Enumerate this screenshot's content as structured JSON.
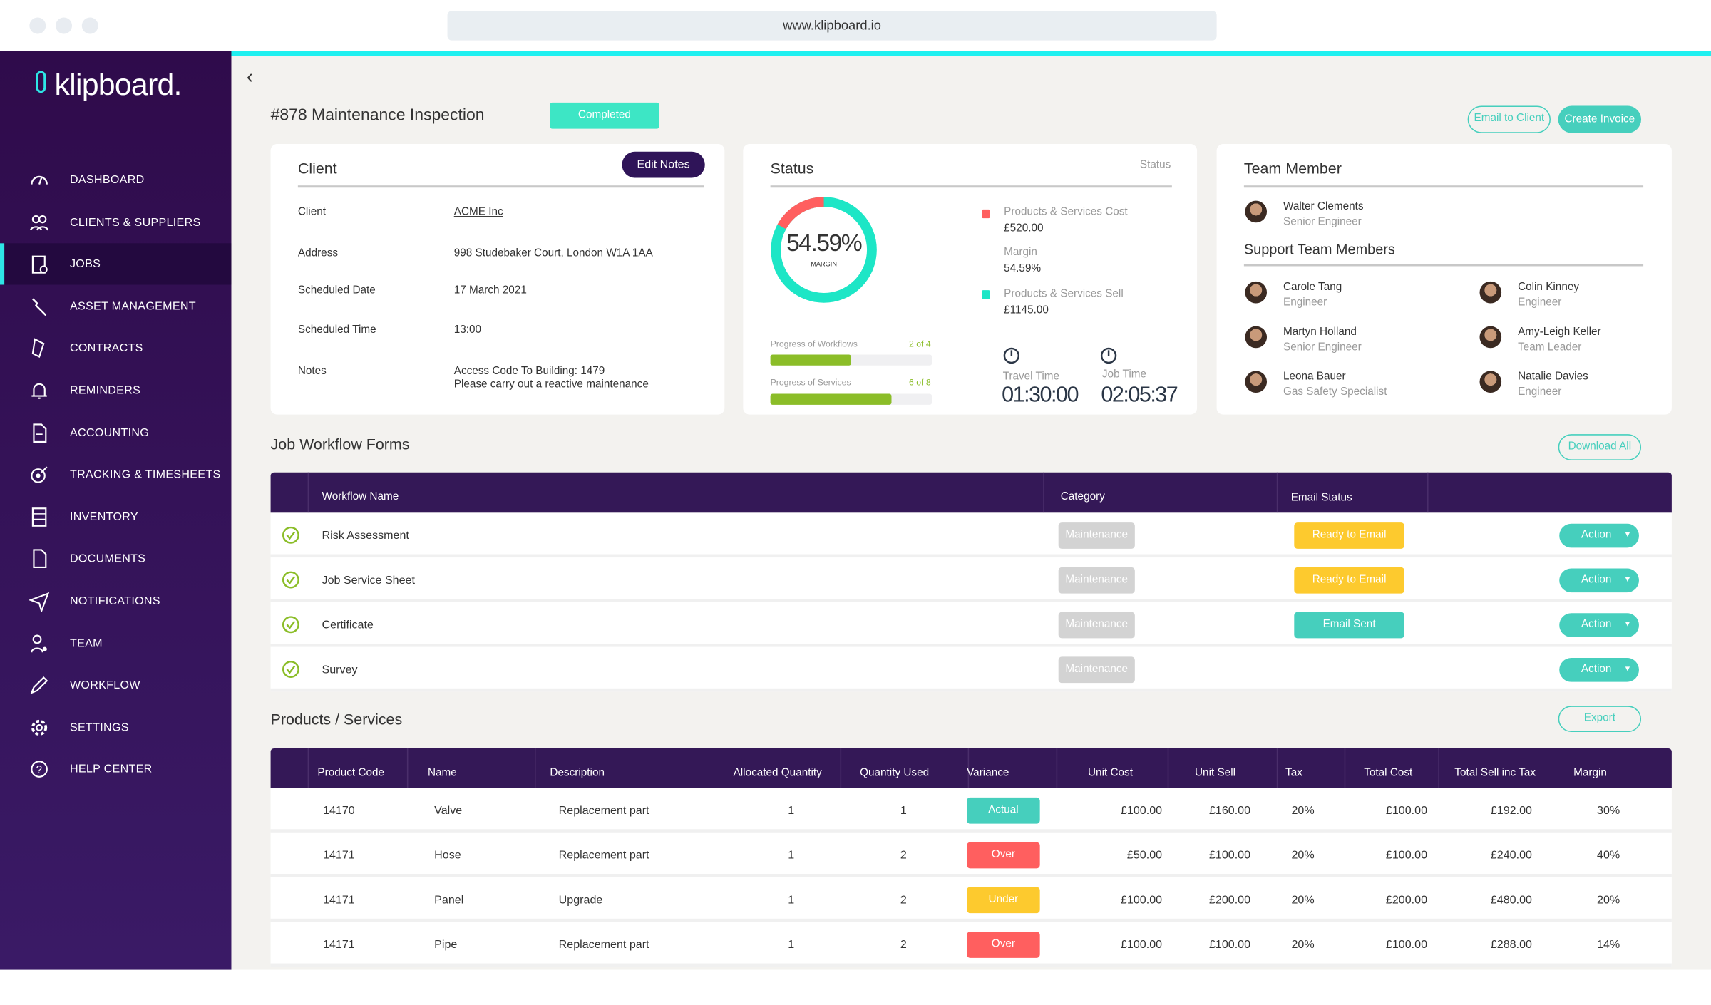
{
  "browser": {
    "url": "www.klipboard.io"
  },
  "brand": {
    "name": "klipboard."
  },
  "colors": {
    "sidebar": "#2f0b4b",
    "accent": "#46cfbd",
    "cyan": "#1ff0f0",
    "header": "#341857",
    "red": "#ff5f5f",
    "yellow": "#fdca2e",
    "green": "#8bbd28",
    "gray_chip": "#d3d3d3"
  },
  "sidebar": {
    "items": [
      {
        "label": "DASHBOARD",
        "icon": "gauge-icon"
      },
      {
        "label": "CLIENTS & SUPPLIERS",
        "icon": "users-icon"
      },
      {
        "label": "JOBS",
        "icon": "clipboard-icon",
        "active": true
      },
      {
        "label": "ASSET MANAGEMENT",
        "icon": "wrench-icon"
      },
      {
        "label": "CONTRACTS",
        "icon": "contract-icon"
      },
      {
        "label": "REMINDERS",
        "icon": "bell-icon"
      },
      {
        "label": "ACCOUNTING",
        "icon": "document-icon"
      },
      {
        "label": "TRACKING & TIMESHEETS",
        "icon": "tracking-icon"
      },
      {
        "label": "INVENTORY",
        "icon": "inventory-icon"
      },
      {
        "label": "DOCUMENTS",
        "icon": "file-icon"
      },
      {
        "label": "NOTIFICATIONS",
        "icon": "paper-plane-icon"
      },
      {
        "label": "TEAM",
        "icon": "team-icon"
      },
      {
        "label": "WORKFLOW",
        "icon": "pencil-icon"
      },
      {
        "label": "SETTINGS",
        "icon": "gear-icon"
      },
      {
        "label": "HELP CENTER",
        "icon": "help-icon"
      }
    ]
  },
  "job": {
    "title": "#878 Maintenance Inspection",
    "status": "Completed",
    "email_client": "Email to Client",
    "create_invoice": "Create Invoice"
  },
  "client": {
    "title": "Client",
    "edit_notes": "Edit Notes",
    "fields": [
      {
        "label": "Client",
        "value": "ACME Inc",
        "link": true
      },
      {
        "label": "Address",
        "value": "998 Studebaker Court, London W1A 1AA"
      },
      {
        "label": "Scheduled Date",
        "value": "17 March 2021"
      },
      {
        "label": "Scheduled Time",
        "value": "13:00"
      },
      {
        "label": "Notes",
        "value": "Access Code To Building: 1479",
        "value2": "Please carry out a reactive maintenance"
      }
    ]
  },
  "status": {
    "title": "Status",
    "right_label": "Status",
    "margin_pct": "54.59%",
    "margin_label": "MARGIN",
    "margin_value": 54.59,
    "cost_label": "Products & Services Cost",
    "cost": "£520.00",
    "margin_text_label": "Margin",
    "margin_text": "54.59%",
    "sell_label": "Products & Services Sell",
    "sell": "£1145.00",
    "workflows_label": "Progress of Workflows",
    "workflows_count": "2 of 4",
    "workflows_progress": 0.5,
    "services_label": "Progress of Services",
    "services_count": "6 of 8",
    "services_progress": 0.75,
    "travel_label": "Travel Time",
    "travel": "01:30:00",
    "job_label": "Job Time",
    "job": "02:05:37"
  },
  "team": {
    "title": "Team Member",
    "lead": {
      "name": "Walter Clements",
      "role": "Senior Engineer"
    },
    "support_title": "Support Team Members",
    "members": [
      {
        "name": "Carole Tang",
        "role": "Engineer"
      },
      {
        "name": "Colin Kinney",
        "role": "Engineer"
      },
      {
        "name": "Martyn Holland",
        "role": "Senior Engineer"
      },
      {
        "name": "Amy-Leigh Keller",
        "role": "Team Leader"
      },
      {
        "name": "Leona Bauer",
        "role": "Gas Safety Specialist"
      },
      {
        "name": "Natalie Davies",
        "role": "Engineer"
      }
    ]
  },
  "workflow": {
    "title": "Job Workflow Forms",
    "download_all": "Download All",
    "headers": [
      "Workflow Name",
      "Category",
      "Email Status"
    ],
    "rows": [
      {
        "name": "Risk Assessment",
        "category": "Maintenance",
        "email_status": "Ready to Email",
        "email_color": "#fdca2e",
        "action": "Action"
      },
      {
        "name": "Job Service Sheet",
        "category": "Maintenance",
        "email_status": "Ready to Email",
        "email_color": "#fdca2e",
        "action": "Action"
      },
      {
        "name": "Certificate",
        "category": "Maintenance",
        "email_status": "Email Sent",
        "email_color": "#46cfbd",
        "action": "Action"
      },
      {
        "name": "Survey",
        "category": "Maintenance",
        "email_status": "",
        "action": "Action"
      }
    ]
  },
  "products": {
    "title": "Products / Services",
    "export": "Export",
    "headers": [
      "Product Code",
      "Name",
      "Description",
      "Allocated Quantity",
      "Quantity Used",
      "Variance",
      "Unit Cost",
      "Unit Sell",
      "Tax",
      "Total Cost",
      "Total Sell inc Tax",
      "Margin"
    ],
    "rows": [
      [
        "14170",
        "Valve",
        "Replacement part",
        "1",
        "1",
        "Actual",
        "£100.00",
        "£160.00",
        "20%",
        "£100.00",
        "£192.00",
        "30%"
      ],
      [
        "14171",
        "Hose",
        "Replacement part",
        "1",
        "2",
        "Over",
        "£50.00",
        "£100.00",
        "20%",
        "£100.00",
        "£240.00",
        "40%"
      ],
      [
        "14171",
        "Panel",
        "Upgrade",
        "1",
        "2",
        "Under",
        "£100.00",
        "£200.00",
        "20%",
        "£200.00",
        "£480.00",
        "20%"
      ],
      [
        "14171",
        "Pipe",
        "Replacement part",
        "1",
        "2",
        "Over",
        "£100.00",
        "£100.00",
        "20%",
        "£100.00",
        "£288.00",
        "14%"
      ]
    ],
    "variance_colors": {
      "Actual": "#46cfbd",
      "Over": "#ff5f5f",
      "Under": "#fdca2e"
    }
  }
}
